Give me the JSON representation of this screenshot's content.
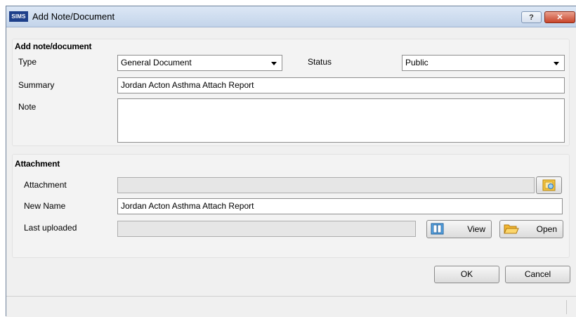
{
  "window": {
    "app_icon_text": "SIMS",
    "title": "Add Note/Document",
    "help_label": "?",
    "close_label": "✕"
  },
  "note_group": {
    "title": "Add note/document",
    "type_label": "Type",
    "type_value": "General Document",
    "status_label": "Status",
    "status_value": "Public",
    "summary_label": "Summary",
    "summary_value": "Jordan Acton Asthma Attach Report",
    "note_label": "Note",
    "note_value": ""
  },
  "attachment_group": {
    "title": "Attachment",
    "attachment_label": "Attachment",
    "attachment_value": "",
    "new_name_label": "New Name",
    "new_name_value": "Jordan Acton Asthma Attach Report",
    "last_uploaded_label": "Last uploaded",
    "last_uploaded_value": "",
    "view_label": "View",
    "open_label": "Open"
  },
  "footer": {
    "ok_label": "OK",
    "cancel_label": "Cancel"
  },
  "icons": {
    "browse": "browse-file-icon",
    "view": "view-document-icon",
    "open": "open-folder-icon"
  }
}
